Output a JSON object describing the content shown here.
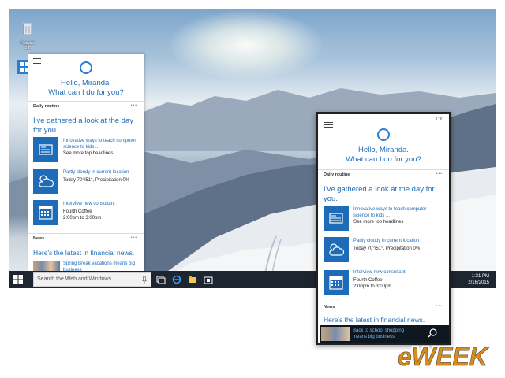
{
  "desktop": {
    "icons": [
      {
        "label": "Recycle Bin"
      }
    ]
  },
  "taskbar": {
    "search_placeholder": "Search the Web and Windows",
    "time": "1:31 PM",
    "date": "2/16/2015"
  },
  "cortana_left": {
    "greeting_line1": "Hello, Miranda.",
    "greeting_line2": "What can I do for you?",
    "section1": "Daily routine",
    "more": "•••",
    "headline1": "I've gathered a look at the day for you.",
    "cards": [
      {
        "link": "Innovative ways to teach computer science to kids ...",
        "text": "See more top headlines",
        "icon": "news-icon"
      },
      {
        "link": "Partly cloudy in current location",
        "text": "Today 70°/51°, Precipitation 0%",
        "icon": "weather-icon"
      },
      {
        "link": "Interview new consultant",
        "text": "Fourth Coffee\n2:00pm to 3:00pm",
        "icon": "calendar-icon"
      }
    ],
    "section2": "News",
    "headline2": "Here's the latest in financial news.",
    "news_item": "Spring Break vacations means big business"
  },
  "cortana_right": {
    "clock": "1:31",
    "greeting_line1": "Hello, Miranda.",
    "greeting_line2": "What can I do for you?",
    "section1": "Daily routine",
    "more": "•••",
    "headline1": "I've gathered a look at the day for you.",
    "cards": [
      {
        "link": "Innovative ways to teach computer science to kids ...",
        "text": "See more top headlines",
        "icon": "news-icon"
      },
      {
        "link": "Partly cloudy in current location",
        "text": "Today 70°/51°, Precipitation 0%",
        "icon": "weather-icon"
      },
      {
        "link": "Interview new consultant",
        "text": "Fourth Coffee\n2:00pm to 3:00pm",
        "icon": "calendar-icon"
      }
    ],
    "section2": "News",
    "headline2": "Here's the latest in financial news.",
    "bottom_text": "Back to school shopping means big business"
  },
  "logo": {
    "text": "eWEEK"
  },
  "colors": {
    "accent": "#1e6bb8",
    "cortana_ring": "#2b7cd3",
    "taskbar": "#1d2530"
  }
}
